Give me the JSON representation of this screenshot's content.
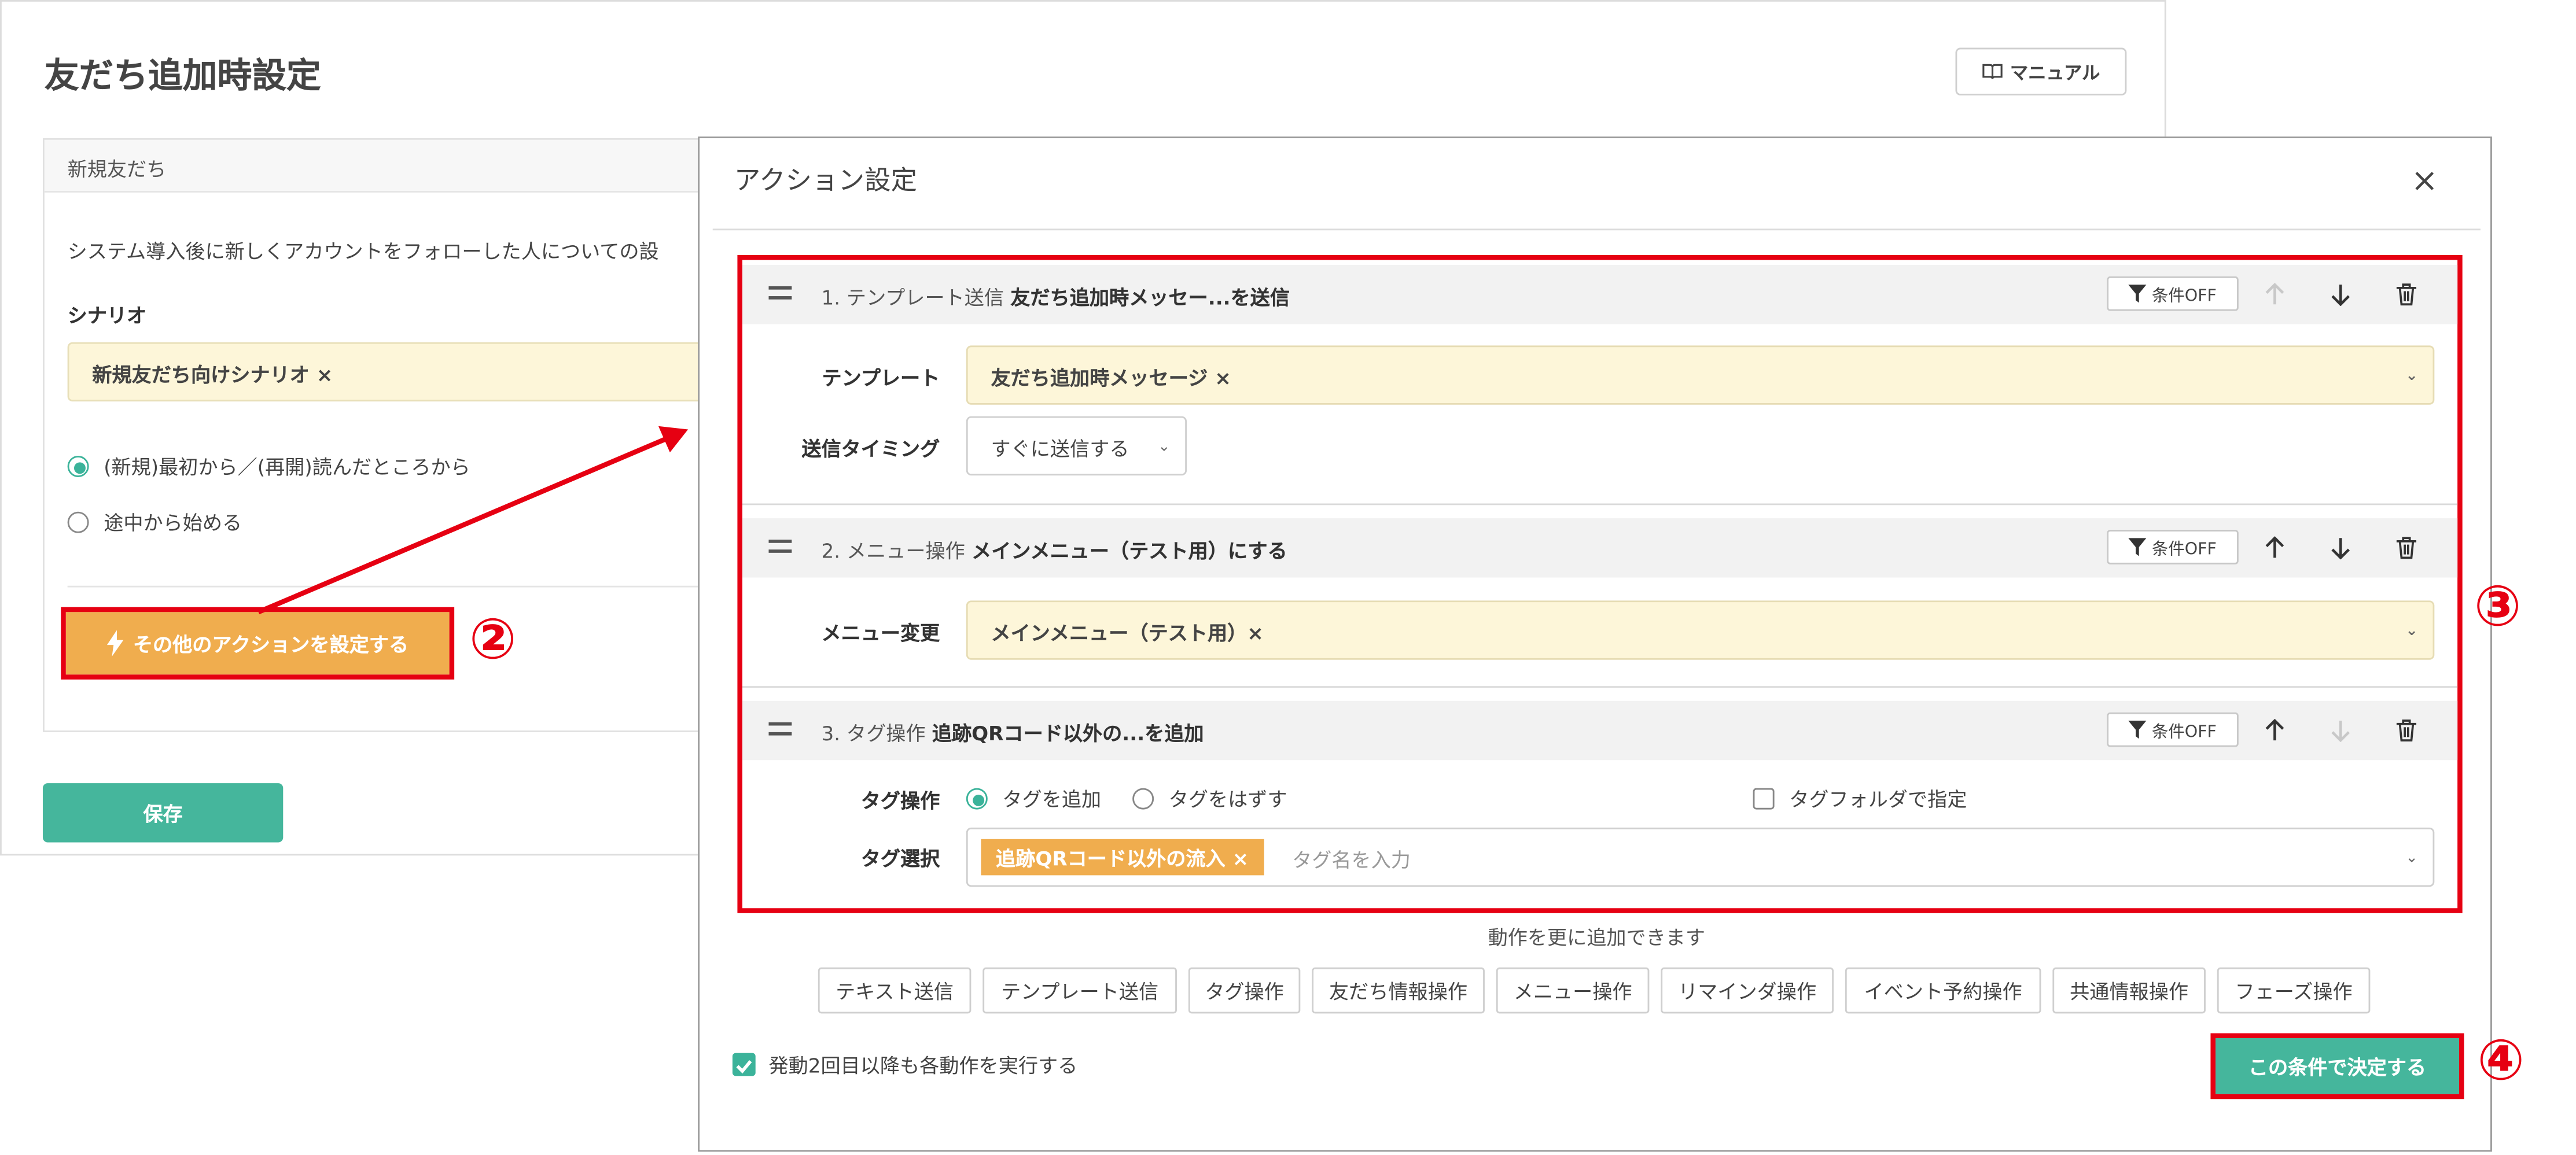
{
  "page": {
    "title": "友だち追加時設定",
    "manual_label": "マニュアル",
    "section_header": "新規友だち",
    "description": "システム導入後に新しくアカウントをフォローした人についての設",
    "scenario_label": "シナリオ",
    "scenario_value": "新規友だち向けシナリオ ×",
    "radio_restart": "(新規)最初から／(再開)読んだところから",
    "radio_middle": "途中から始める",
    "other_actions_button": "その他のアクションを設定する",
    "save_button": "保存"
  },
  "annotations": {
    "step2": "②",
    "step3": "③",
    "step4": "④"
  },
  "modal": {
    "title": "アクション設定",
    "condition_label": "条件OFF",
    "actions": [
      {
        "number": "1. テンプレート送信",
        "summary": "友だち追加時メッセー...を送信",
        "template_label": "テンプレート",
        "template_value": "友だち追加時メッセージ ×",
        "timing_label": "送信タイミング",
        "timing_value": "すぐに送信する"
      },
      {
        "number": "2. メニュー操作",
        "summary": "メインメニュー（テスト用）にする",
        "menu_label": "メニュー変更",
        "menu_value": "メインメニュー（テスト用）×"
      },
      {
        "number": "3. タグ操作",
        "summary": "追跡QRコード以外の...を追加",
        "tag_op_label": "タグ操作",
        "add_tag": "タグを追加",
        "remove_tag": "タグをはずす",
        "folder_option": "タグフォルダで指定",
        "tag_select_label": "タグ選択",
        "tag_chip": "追跡QRコード以外の流入 ×",
        "tag_placeholder": "タグ名を入力"
      }
    ],
    "add_hint": "動作を更に追加できます",
    "add_buttons": [
      "テキスト送信",
      "テンプレート送信",
      "タグ操作",
      "友だち情報操作",
      "メニュー操作",
      "リマインダ操作",
      "イベント予約操作",
      "共通情報操作",
      "フェーズ操作"
    ],
    "repeat_label": "発動2回目以降も各動作を実行する",
    "decide_button": "この条件で決定する"
  },
  "colors": {
    "accent_green": "#45b69c",
    "highlight_red": "#e60012",
    "orange": "#f0ad4e",
    "select_yellow": "#fdf6d9"
  },
  "icons": [
    "book-icon",
    "lightning-icon",
    "close-icon",
    "drag-handle-icon",
    "filter-icon",
    "arrow-up-icon",
    "arrow-down-icon",
    "trash-icon",
    "chevron-down-icon",
    "check-icon"
  ]
}
